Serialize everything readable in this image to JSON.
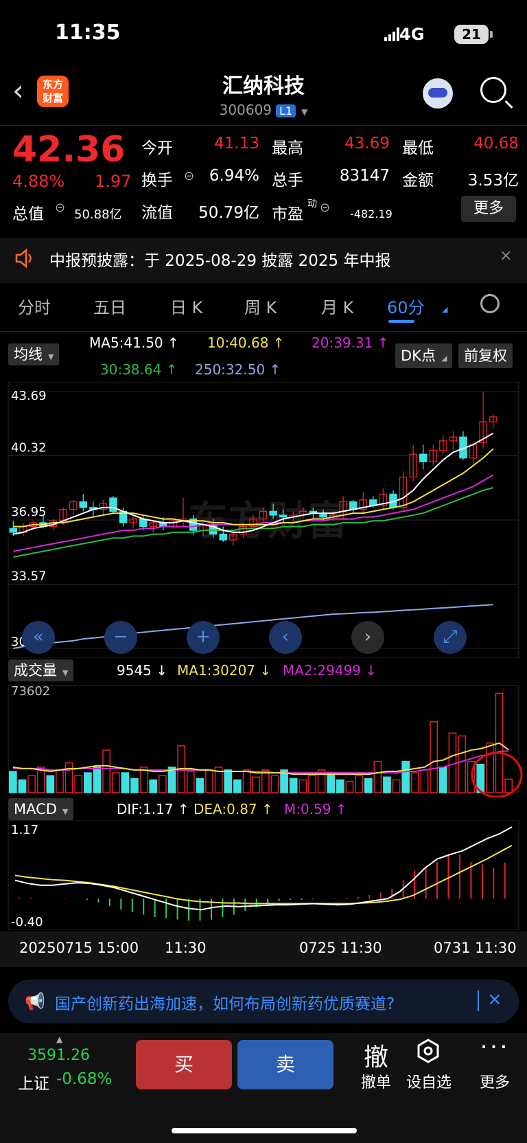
{
  "status_bar": {
    "time": "11:35",
    "network": "4G",
    "battery": "21"
  },
  "header": {
    "back_icon": "chevron-left-icon",
    "logo_line1": "东方",
    "logo_line2": "财富",
    "title": "汇纳科技",
    "code": "300609",
    "level_badge": "L1"
  },
  "quote": {
    "price": "42.36",
    "change_pct": "4.88%",
    "change": "1.97",
    "open_label": "今开",
    "open": "41.13",
    "high_label": "最高",
    "high": "43.69",
    "low_label": "最低",
    "low": "40.68",
    "turnover_label": "换手",
    "turnover": "6.94%",
    "volume_label": "总手",
    "volume": "83147",
    "amount_label": "金额",
    "amount": "3.53亿",
    "mktcap_label": "总值",
    "mktcap": "50.88亿",
    "float_label": "流值",
    "float_cap": "50.79亿",
    "pe_label": "市盈",
    "pe_sup": "动",
    "pe": "-482.19",
    "more": "更多"
  },
  "notice": {
    "text": "中报预披露：于 2025-08-29 披露 2025 年中报",
    "close": "×"
  },
  "tabs": [
    "分时",
    "五日",
    "日 K",
    "周 K",
    "月 K",
    "60分"
  ],
  "active_tab": "60分",
  "ma_legend": {
    "selector": "均线",
    "ma5": "MA5:41.50 ↑",
    "ma10": "10:40.68 ↑",
    "ma20": "20:39.31 ↑",
    "ma30": "30:38.64 ↑",
    "ma250": "250:32.50 ↑",
    "dk_button": "DK点",
    "adjust_button": "前复权"
  },
  "price_axis": [
    "43.69",
    "40.32",
    "36.95",
    "33.57",
    "30.20"
  ],
  "volume_legend": {
    "selector": "成交量",
    "vol": "9545 ↓",
    "ma1": "MA1:30207 ↓",
    "ma2": "MA2:29499 ↓",
    "axis_max": "73602"
  },
  "macd_legend": {
    "selector": "MACD",
    "dif": "DIF:1.17 ↑",
    "dea": "DEA:0.87 ↑",
    "m": "M:0.59 ↑",
    "axis_max": "1.17",
    "axis_min": "-0.40"
  },
  "time_axis": [
    "20250715 15:00",
    "11:30",
    "0725 11:30",
    "0731 11:30"
  ],
  "watermark": "东方财富",
  "colors": {
    "up": "#f0282c",
    "down": "#2ad14e",
    "down_candle": "#3ee0e0",
    "ma5": "#ffffff",
    "ma10": "#f4e04b",
    "ma20": "#d42ad6",
    "ma30": "#2fb847",
    "ma250": "#8fa6e6",
    "accent": "#3d8cff"
  },
  "chart_controls": [
    "double-left-icon",
    "minus-icon",
    "plus-icon",
    "left-icon",
    "right-icon",
    "expand-icon"
  ],
  "banner": {
    "icon": "megaphone-icon",
    "text": "国产创新药出海加速，如何布局创新药优质赛道?",
    "close": "×"
  },
  "bottom": {
    "index_value": "3591.26",
    "index_name": "上证",
    "index_pct": "-0.68%",
    "buy": "买",
    "sell": "卖",
    "cancel_icon_char": "撤",
    "cancel": "撤单",
    "watch": "设自选",
    "more": "更多"
  },
  "chart_data": {
    "type": "candlestick",
    "range": [
      30.2,
      43.69
    ],
    "candles": [
      [
        36.5,
        36.9,
        36.1,
        36.3
      ],
      [
        36.3,
        36.8,
        36.1,
        36.6
      ],
      [
        36.6,
        36.9,
        36.4,
        36.8
      ],
      [
        36.8,
        37.2,
        36.5,
        36.6
      ],
      [
        36.6,
        37.0,
        36.4,
        36.9
      ],
      [
        36.9,
        37.6,
        36.7,
        37.5
      ],
      [
        37.5,
        38.0,
        37.2,
        37.9
      ],
      [
        37.9,
        38.3,
        37.4,
        37.6
      ],
      [
        37.6,
        37.9,
        37.1,
        37.5
      ],
      [
        37.5,
        38.0,
        37.2,
        37.8
      ],
      [
        38.1,
        38.2,
        37.3,
        37.4
      ],
      [
        37.4,
        37.6,
        36.6,
        36.8
      ],
      [
        36.8,
        37.1,
        36.5,
        37.0
      ],
      [
        37.0,
        37.2,
        36.4,
        36.6
      ],
      [
        36.6,
        36.9,
        36.3,
        36.8
      ],
      [
        36.8,
        37.1,
        36.4,
        36.6
      ],
      [
        36.6,
        37.0,
        36.5,
        36.9
      ],
      [
        36.9,
        38.1,
        36.6,
        37.0
      ],
      [
        37.0,
        37.2,
        36.2,
        36.4
      ],
      [
        36.4,
        36.9,
        36.1,
        36.7
      ],
      [
        36.7,
        37.0,
        36.0,
        36.2
      ],
      [
        36.2,
        36.6,
        35.8,
        35.9
      ],
      [
        35.9,
        36.4,
        35.6,
        36.2
      ],
      [
        36.2,
        36.8,
        36.0,
        36.6
      ],
      [
        36.6,
        37.2,
        36.4,
        37.0
      ],
      [
        37.0,
        37.6,
        36.8,
        37.4
      ],
      [
        37.4,
        37.8,
        37.0,
        37.2
      ],
      [
        37.2,
        37.5,
        36.8,
        37.1
      ],
      [
        37.1,
        37.4,
        36.9,
        37.2
      ],
      [
        37.2,
        37.6,
        37.0,
        37.4
      ],
      [
        37.4,
        37.6,
        37.0,
        37.3
      ],
      [
        37.3,
        37.5,
        36.9,
        37.1
      ],
      [
        37.1,
        37.4,
        36.9,
        37.2
      ],
      [
        37.2,
        38.2,
        37.0,
        37.9
      ],
      [
        37.9,
        38.0,
        37.3,
        37.5
      ],
      [
        37.5,
        38.4,
        37.3,
        38.0
      ],
      [
        38.0,
        38.2,
        37.6,
        37.7
      ],
      [
        37.7,
        38.6,
        37.5,
        38.3
      ],
      [
        38.3,
        38.5,
        37.5,
        37.6
      ],
      [
        37.6,
        39.5,
        37.4,
        39.2
      ],
      [
        39.2,
        40.9,
        39.0,
        40.4
      ],
      [
        40.4,
        40.9,
        39.6,
        40.0
      ],
      [
        40.0,
        40.9,
        39.8,
        40.6
      ],
      [
        40.6,
        41.4,
        40.4,
        41.1
      ],
      [
        41.1,
        41.6,
        40.6,
        41.3
      ],
      [
        41.3,
        41.6,
        40.1,
        40.2
      ],
      [
        40.2,
        41.0,
        39.9,
        40.9
      ],
      [
        41.0,
        43.69,
        40.7,
        42.1
      ],
      [
        42.1,
        42.5,
        41.8,
        42.36
      ]
    ],
    "ma5": [
      36.2,
      36.3,
      36.5,
      36.6,
      36.7,
      36.9,
      37.1,
      37.3,
      37.5,
      37.6,
      37.6,
      37.4,
      37.2,
      37.0,
      36.9,
      36.8,
      36.8,
      36.9,
      36.8,
      36.7,
      36.6,
      36.4,
      36.3,
      36.3,
      36.4,
      36.6,
      36.8,
      37.0,
      37.1,
      37.2,
      37.3,
      37.3,
      37.3,
      37.4,
      37.5,
      37.6,
      37.7,
      37.8,
      37.9,
      38.1,
      38.5,
      39.1,
      39.6,
      40.1,
      40.5,
      40.7,
      40.9,
      41.2,
      41.5
    ],
    "ma10": [
      36.6,
      36.6,
      36.7,
      36.7,
      36.8,
      36.8,
      36.9,
      37.0,
      37.1,
      37.2,
      37.3,
      37.3,
      37.3,
      37.2,
      37.1,
      37.0,
      37.0,
      36.9,
      36.9,
      36.9,
      36.8,
      36.8,
      36.7,
      36.7,
      36.7,
      36.7,
      36.7,
      36.8,
      36.8,
      36.9,
      37.0,
      37.0,
      37.1,
      37.2,
      37.3,
      37.3,
      37.4,
      37.5,
      37.6,
      37.7,
      37.9,
      38.2,
      38.5,
      38.8,
      39.1,
      39.4,
      39.8,
      40.2,
      40.68
    ],
    "ma20": [
      35.3,
      35.4,
      35.5,
      35.6,
      35.7,
      35.8,
      35.9,
      36.0,
      36.1,
      36.2,
      36.3,
      36.4,
      36.4,
      36.5,
      36.5,
      36.6,
      36.6,
      36.6,
      36.6,
      36.7,
      36.7,
      36.7,
      36.7,
      36.7,
      36.7,
      36.8,
      36.8,
      36.8,
      36.8,
      36.9,
      36.9,
      36.9,
      37.0,
      37.0,
      37.0,
      37.1,
      37.1,
      37.2,
      37.3,
      37.4,
      37.5,
      37.7,
      37.9,
      38.1,
      38.3,
      38.5,
      38.7,
      39.0,
      39.31
    ],
    "ma30": [
      35.0,
      35.1,
      35.2,
      35.3,
      35.4,
      35.5,
      35.6,
      35.7,
      35.8,
      35.9,
      36.0,
      36.0,
      36.1,
      36.1,
      36.2,
      36.2,
      36.3,
      36.3,
      36.3,
      36.4,
      36.4,
      36.4,
      36.4,
      36.5,
      36.5,
      36.5,
      36.5,
      36.6,
      36.6,
      36.6,
      36.7,
      36.7,
      36.7,
      36.8,
      36.8,
      36.8,
      36.9,
      36.9,
      37.0,
      37.1,
      37.2,
      37.3,
      37.5,
      37.7,
      37.9,
      38.1,
      38.3,
      38.5,
      38.64
    ],
    "ma250": [
      30.2,
      30.3,
      30.35,
      30.4,
      30.5,
      30.55,
      30.6,
      30.7,
      30.75,
      30.8,
      30.9,
      30.95,
      31.0,
      31.05,
      31.1,
      31.15,
      31.2,
      31.25,
      31.3,
      31.35,
      31.4,
      31.45,
      31.5,
      31.55,
      31.6,
      31.65,
      31.7,
      31.75,
      31.8,
      31.85,
      31.9,
      31.95,
      32.0,
      32.02,
      32.05,
      32.08,
      32.1,
      32.13,
      32.16,
      32.2,
      32.23,
      32.26,
      32.3,
      32.33,
      32.36,
      32.4,
      32.43,
      32.47,
      32.5
    ],
    "volume": {
      "max": 73602,
      "values": [
        15000,
        9000,
        12000,
        18000,
        12000,
        16000,
        21000,
        12000,
        14000,
        18000,
        30000,
        14000,
        14000,
        10000,
        18000,
        9000,
        12000,
        18000,
        33000,
        15000,
        10000,
        16000,
        18000,
        16000,
        9000,
        16000,
        11000,
        16000,
        12000,
        16000,
        10000,
        9000,
        12000,
        16000,
        14000,
        9000,
        8000,
        12000,
        10000,
        22000,
        11000,
        9000,
        22000,
        14000,
        16000,
        50000,
        18000,
        42000,
        40000,
        22000,
        20000,
        35000,
        70000,
        9545
      ],
      "ma1": [
        18000,
        17000,
        17000,
        16000,
        15000,
        16000,
        17000,
        17000,
        18000,
        19000,
        19000,
        18000,
        17000,
        16000,
        16000,
        15000,
        15000,
        16000,
        17000,
        17000,
        16000,
        16000,
        15000,
        15000,
        15000,
        15000,
        14000,
        14000,
        14000,
        14000,
        13000,
        13000,
        13000,
        13000,
        13000,
        13000,
        13000,
        13000,
        13000,
        14000,
        15000,
        15000,
        16000,
        17000,
        18000,
        22000,
        23000,
        26000,
        28000,
        30000,
        31000,
        33000,
        35000,
        30207
      ],
      "ma2": [
        17000,
        17000,
        17000,
        17000,
        16000,
        16000,
        16000,
        17000,
        17000,
        17000,
        17000,
        17000,
        17000,
        16000,
        16000,
        16000,
        16000,
        16000,
        16000,
        16000,
        16000,
        16000,
        15000,
        15000,
        15000,
        15000,
        15000,
        15000,
        14000,
        14000,
        14000,
        14000,
        14000,
        14000,
        14000,
        14000,
        14000,
        14000,
        14000,
        14000,
        14000,
        14000,
        15000,
        15000,
        16000,
        17000,
        18000,
        20000,
        22000,
        24000,
        26000,
        27000,
        29000,
        29499
      ]
    },
    "macd": {
      "range": [
        -0.4,
        1.17
      ],
      "dif": [
        0.3,
        0.25,
        0.22,
        0.22,
        0.24,
        0.26,
        0.25,
        0.22,
        0.18,
        0.12,
        0.06,
        0.0,
        -0.06,
        -0.12,
        -0.16,
        -0.18,
        -0.14,
        -0.12,
        -0.13,
        -0.12,
        -0.11,
        -0.1,
        -0.1,
        -0.09,
        -0.08,
        -0.09,
        -0.1,
        -0.09,
        -0.06,
        -0.03,
        0.0,
        0.12,
        0.3,
        0.5,
        0.65,
        0.72,
        0.78,
        0.88,
        0.98,
        1.06,
        1.17
      ],
      "dea": [
        0.38,
        0.35,
        0.33,
        0.31,
        0.3,
        0.28,
        0.26,
        0.23,
        0.2,
        0.16,
        0.12,
        0.08,
        0.04,
        0.0,
        -0.03,
        -0.05,
        -0.06,
        -0.07,
        -0.07,
        -0.08,
        -0.08,
        -0.08,
        -0.08,
        -0.08,
        -0.08,
        -0.08,
        -0.08,
        -0.08,
        -0.07,
        -0.06,
        -0.04,
        -0.01,
        0.05,
        0.15,
        0.25,
        0.35,
        0.45,
        0.55,
        0.65,
        0.76,
        0.87
      ],
      "hist": [
        0.02,
        0.02,
        0.0,
        0.0,
        0.01,
        0.0,
        -0.02,
        -0.06,
        -0.12,
        -0.18,
        -0.22,
        -0.26,
        -0.3,
        -0.32,
        -0.34,
        -0.36,
        -0.36,
        -0.34,
        -0.3,
        -0.26,
        -0.2,
        -0.14,
        -0.08,
        -0.04,
        -0.02,
        -0.02,
        -0.01,
        0.0,
        0.01,
        0.02,
        0.03,
        0.06,
        0.1,
        0.16,
        0.3,
        0.46,
        0.54,
        0.6,
        0.7,
        0.72,
        0.6,
        0.56,
        0.5,
        0.59
      ]
    }
  }
}
